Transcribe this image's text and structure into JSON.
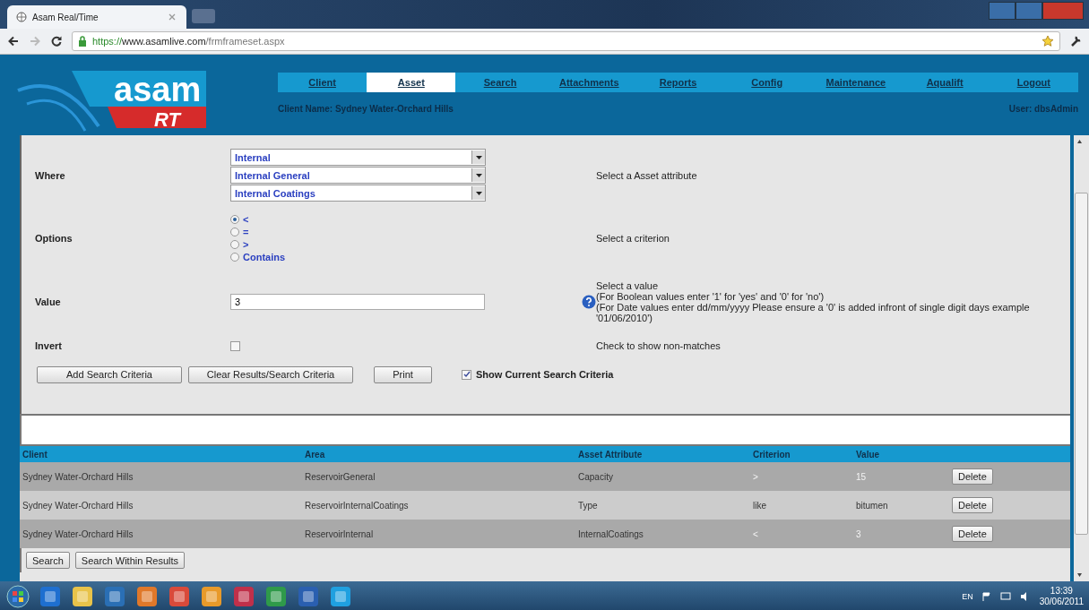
{
  "browser": {
    "tab_title": "Asam Real/Time",
    "url": {
      "scheme": "https://",
      "host": "www.asamlive.com",
      "path": "/frmframeset.aspx"
    }
  },
  "header": {
    "logo_main": "asam",
    "logo_sub": "RT",
    "nav": [
      {
        "label": "Client",
        "selected": false
      },
      {
        "label": "Asset",
        "selected": true
      },
      {
        "label": "Search",
        "selected": false
      },
      {
        "label": "Attachments",
        "selected": false
      },
      {
        "label": "Reports",
        "selected": false
      },
      {
        "label": "Config",
        "selected": false
      },
      {
        "label": "Maintenance",
        "selected": false
      },
      {
        "label": "Aqualift",
        "selected": false
      },
      {
        "label": "Logout",
        "selected": false
      }
    ],
    "client_name": "Client Name:  Sydney Water-Orchard Hills",
    "user": "User: dbsAdmin"
  },
  "form": {
    "where": {
      "label": "Where",
      "selects": [
        "Internal",
        "Internal General",
        "Internal Coatings"
      ],
      "hint": "Select a Asset attribute"
    },
    "options": {
      "label": "Options",
      "radios": [
        {
          "label": "<",
          "selected": true
        },
        {
          "label": "=",
          "selected": false
        },
        {
          "label": ">",
          "selected": false
        },
        {
          "label": "Contains",
          "selected": false
        }
      ],
      "hint": "Select a criterion"
    },
    "value": {
      "label": "Value",
      "value": "3",
      "hint_lines": [
        "Select a value",
        "(For Boolean values enter '1' for 'yes' and '0' for 'no')",
        "(For Date values enter dd/mm/yyyy Please ensure a '0'  is added infront of single digit days example '01/06/2010')"
      ]
    },
    "invert": {
      "label": "Invert",
      "checked": false,
      "hint": "Check to show non-matches"
    },
    "buttons": [
      "Add Search Criteria",
      "Clear Results/Search Criteria",
      "Print"
    ],
    "show_criteria": {
      "label": "Show Current Search Criteria",
      "checked": true
    }
  },
  "table": {
    "columns": [
      "Client",
      "Area",
      "Asset Attribute",
      "Criterion",
      "Value"
    ],
    "rows": [
      {
        "cells": [
          "Sydney Water-Orchard Hills",
          "ReservoirGeneral",
          "Capacity",
          ">",
          "15"
        ],
        "action": "Delete"
      },
      {
        "cells": [
          "Sydney Water-Orchard Hills",
          "ReservoirInternalCoatings",
          "Type",
          "like",
          "bitumen"
        ],
        "action": "Delete"
      },
      {
        "cells": [
          "Sydney Water-Orchard Hills",
          "ReservoirInternal",
          "InternalCoatings",
          "<",
          "3"
        ],
        "action": "Delete"
      }
    ]
  },
  "bottom_buttons": [
    "Search",
    "Search Within Results"
  ],
  "taskbar": {
    "apps": [
      {
        "color": "#1e6fd0"
      },
      {
        "color": "#e8c34a"
      },
      {
        "color": "#2a6fb5"
      },
      {
        "color": "#e0782a"
      },
      {
        "color": "#d94a3a"
      },
      {
        "color": "#e89a2a"
      },
      {
        "color": "#c0304a"
      },
      {
        "color": "#2f9a4a"
      },
      {
        "color": "#2a5fb0"
      },
      {
        "color": "#1fa0e0"
      }
    ],
    "language": "EN",
    "time": "13:39",
    "date": "30/06/2011"
  }
}
